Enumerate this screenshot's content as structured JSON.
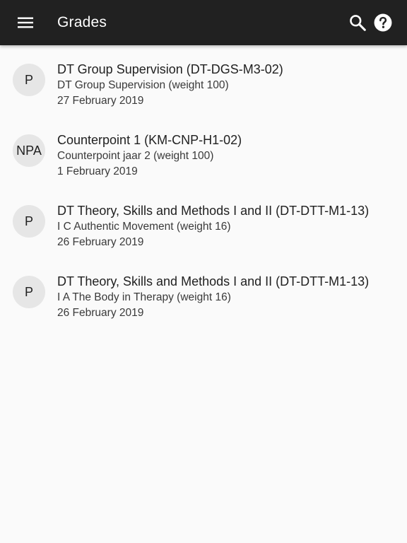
{
  "appbar": {
    "title": "Grades",
    "icons": {
      "menu": "menu-icon",
      "search": "search-icon",
      "help": "help-icon"
    },
    "background": "#212121"
  },
  "grades": [
    {
      "avatar": "P",
      "course": "DT Group Supervision (DT-DGS-M3-02)",
      "detail": "DT Group Supervision (weight 100)",
      "date": "27 February 2019"
    },
    {
      "avatar": "NPA",
      "course": "Counterpoint 1 (KM-CNP-H1-02)",
      "detail": "Counterpoint jaar 2 (weight 100)",
      "date": "1 February 2019"
    },
    {
      "avatar": "P",
      "course": "DT Theory, Skills and Methods I and II (DT-DTT-M1-13)",
      "detail": "I C Authentic Movement (weight 16)",
      "date": "26 February 2019"
    },
    {
      "avatar": "P",
      "course": "DT Theory, Skills and Methods I and II (DT-DTT-M1-13)",
      "detail": "I A The Body in Therapy (weight 16)",
      "date": "26 February 2019"
    }
  ]
}
